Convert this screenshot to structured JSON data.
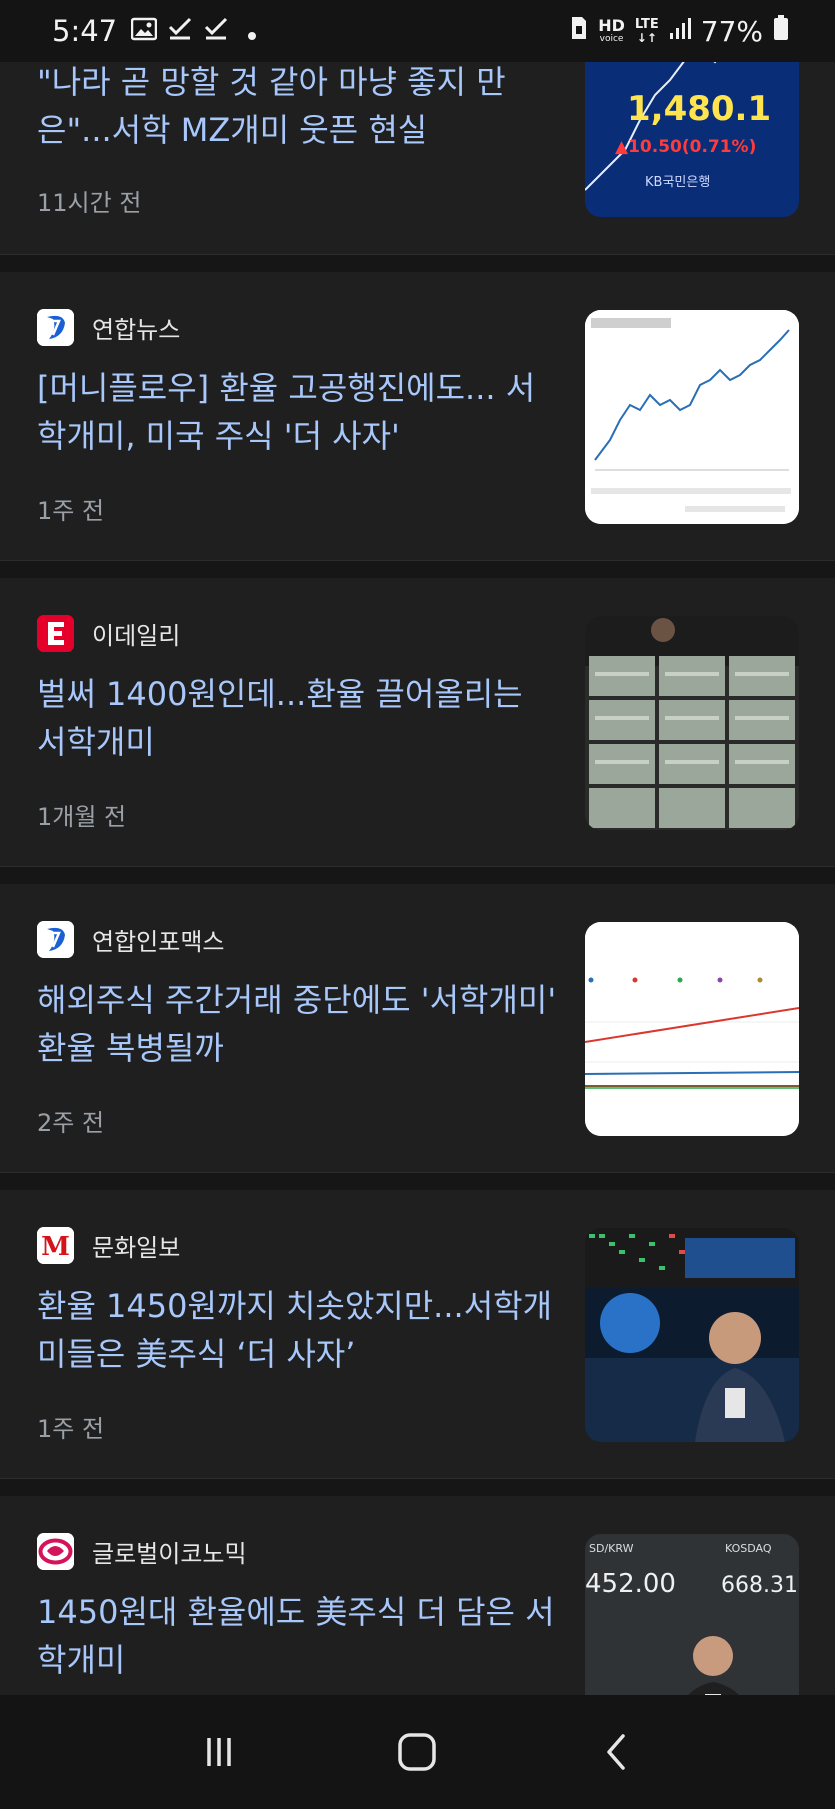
{
  "status_bar": {
    "time": "5:47",
    "hd_label": "HD",
    "voice_label": "voice",
    "lte_label": "LTE",
    "battery": "77%",
    "icons": [
      "gallery-icon",
      "check-icon",
      "check-icon",
      "dot-icon",
      "sim-icon",
      "signal-icon",
      "battery-icon"
    ]
  },
  "articles": [
    {
      "source": "",
      "headline": "\"나라 곧 망할 것 같아 마냥 좋지 만은\"...서학 MZ개미 웃픈 현실",
      "time_ago": "11시간 전",
      "thumb_text_1": "1,480.1",
      "thumb_text_2": "▲10.50(0.71%)",
      "thumb_text_3": "KB국민은행"
    },
    {
      "source": "연합뉴스",
      "headline": "[머니플로우] 환율 고공행진에도... 서학개미, 미국 주식 '더 사자'",
      "time_ago": "1주 전"
    },
    {
      "source": "이데일리",
      "headline": "벌써 1400원인데...환율 끌어올리는 서학개미",
      "time_ago": "1개월 전"
    },
    {
      "source": "연합인포맥스",
      "headline": "해외주식 주간거래 중단에도 '서학개미' 환율 복병될까",
      "time_ago": "2주 전"
    },
    {
      "source": "문화일보",
      "headline": "환율 1450원까지 치솟았지만...서학개미들은 美주식 ‘더 사자’",
      "time_ago": "1주 전"
    },
    {
      "source": "글로벌이코노믹",
      "headline": "1450원대 환율에도 美주식 더 담은 서학개미",
      "time_ago": "",
      "thumb_text_1": "452.00",
      "thumb_text_2": "668.31",
      "thumb_text_3": "KOSDAQ",
      "thumb_text_4": "SD/KRW"
    }
  ],
  "nav": [
    "recent-apps-icon",
    "home-icon",
    "back-icon"
  ],
  "colors": {
    "headline": "#a8c7fa",
    "background": "#1f1f1f",
    "meta": "#9aa0a6"
  }
}
